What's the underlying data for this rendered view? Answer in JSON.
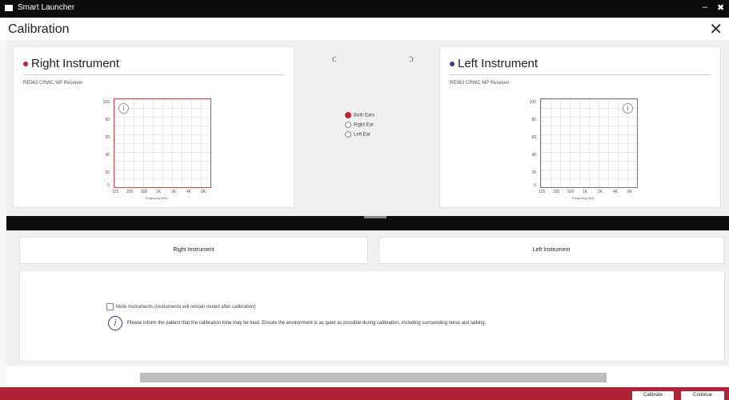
{
  "app": {
    "name": "Smart Launcher",
    "window_minimize": "–",
    "window_close": "✖"
  },
  "header": {
    "title": "Calibration",
    "close_glyph": "✕"
  },
  "right_panel": {
    "title": "Right Instrument",
    "receiver": "RE963 CRWC MP Receiver",
    "dot_color": "#c0223a",
    "plot_border_color": "#d94050",
    "y_ticks": [
      "100",
      "80",
      "60",
      "40",
      "20",
      "0"
    ],
    "x_ticks": [
      "125",
      "250",
      "500",
      "1K",
      "2K",
      "4K",
      "8K"
    ],
    "x_label": "Frequency (Hz)"
  },
  "left_panel": {
    "title": "Left Instrument",
    "receiver": "RE963 CRWC MP Receiver",
    "dot_color": "#3f3a8f",
    "plot_border_color": "#777777",
    "y_ticks": [
      "100",
      "80",
      "60",
      "40",
      "20",
      "0"
    ],
    "x_ticks": [
      "125",
      "250",
      "500",
      "1K",
      "2K",
      "4K",
      "8K"
    ],
    "x_label": "Frequency (Hz)"
  },
  "middle": {
    "ear_left": "ᑕ",
    "ear_right": "ᑐ",
    "options": [
      {
        "label": "Both Ears",
        "checked": true
      },
      {
        "label": "Right Ear",
        "checked": false
      },
      {
        "label": "Left Ear",
        "checked": false
      }
    ]
  },
  "tabs": {
    "right": "Right Instrument",
    "left": "Left Instrument"
  },
  "content": {
    "mute_label": "Mute Instruments (Instruments will remain muted after calibration)",
    "note": "Please inform the patient that the calibration tone may be loud. Ensure the environment is as quiet as possible during calibration, including surrounding noise and talking."
  },
  "footer": {
    "calibrate": "Calibrate",
    "continue": "Continue",
    "color": "#b02235"
  }
}
